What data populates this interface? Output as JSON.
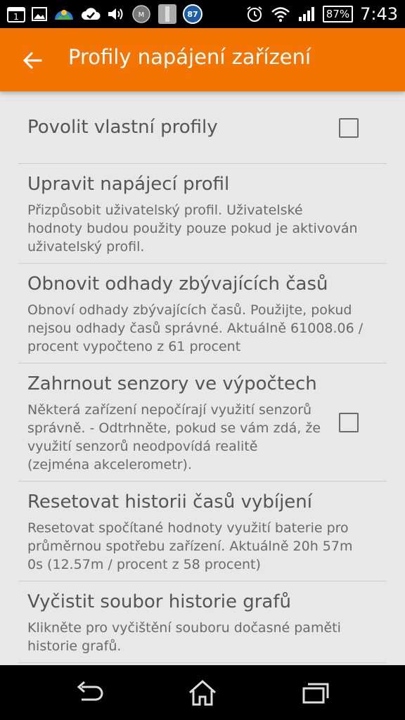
{
  "status_bar": {
    "notification_badge": "1",
    "app_badge": "87",
    "battery": "87%",
    "time": "7:43",
    "icons": [
      "calendar-icon",
      "image-icon",
      "weather-icon",
      "checkmark-cloud-icon",
      "volume-icon",
      "shield-app-icon",
      "phone-app-icon",
      "badge-87-icon",
      "alarm-icon",
      "wifi-icon",
      "signal-icon",
      "battery-icon"
    ]
  },
  "app_bar": {
    "title": "Profily napájení zařízení",
    "accent_color": "#f37303"
  },
  "settings": [
    {
      "title": "Povolit vlastní profily",
      "summary": "",
      "checkbox": true,
      "checked": false
    },
    {
      "title": "Upravit napájecí profil",
      "summary": "Přizpůsobit uživatelský profil. Uživatelské hodnoty budou použity pouze pokud je aktivován uživatelský profil.",
      "checkbox": false
    },
    {
      "title": "Obnovit odhady zbývajících časů",
      "summary": "Obnoví odhady zbývajících časů. Použijte, pokud nejsou odhady časů správné. Aktuálně 61008.06 / procent vypočteno z 61 procent",
      "checkbox": false
    },
    {
      "title": "Zahrnout senzory ve výpočtech",
      "summary": "Některá zařízení nepočírají využití senzorů správně. - Odtrhněte, pokud se vám zdá, že využití senzorů neodpovídá realitě (zejména akcelerometr).",
      "checkbox": true,
      "checked": false
    },
    {
      "title": "Resetovat historii časů vybíjení",
      "summary": "Resetovat spočítané hodnoty využití baterie pro průměrnou spotřebu zařízení. Aktuálně 20h 57m 0s (12.57m / procent z 58 procent)",
      "checkbox": false
    },
    {
      "title": "Vyčistit soubor historie grafů",
      "summary": "Klikněte pro vyčištění souboru dočasné paměti historie grafů.",
      "checkbox": false
    }
  ],
  "nav_bar": {
    "icons": [
      "back-nav-icon",
      "home-nav-icon",
      "recents-nav-icon"
    ]
  }
}
